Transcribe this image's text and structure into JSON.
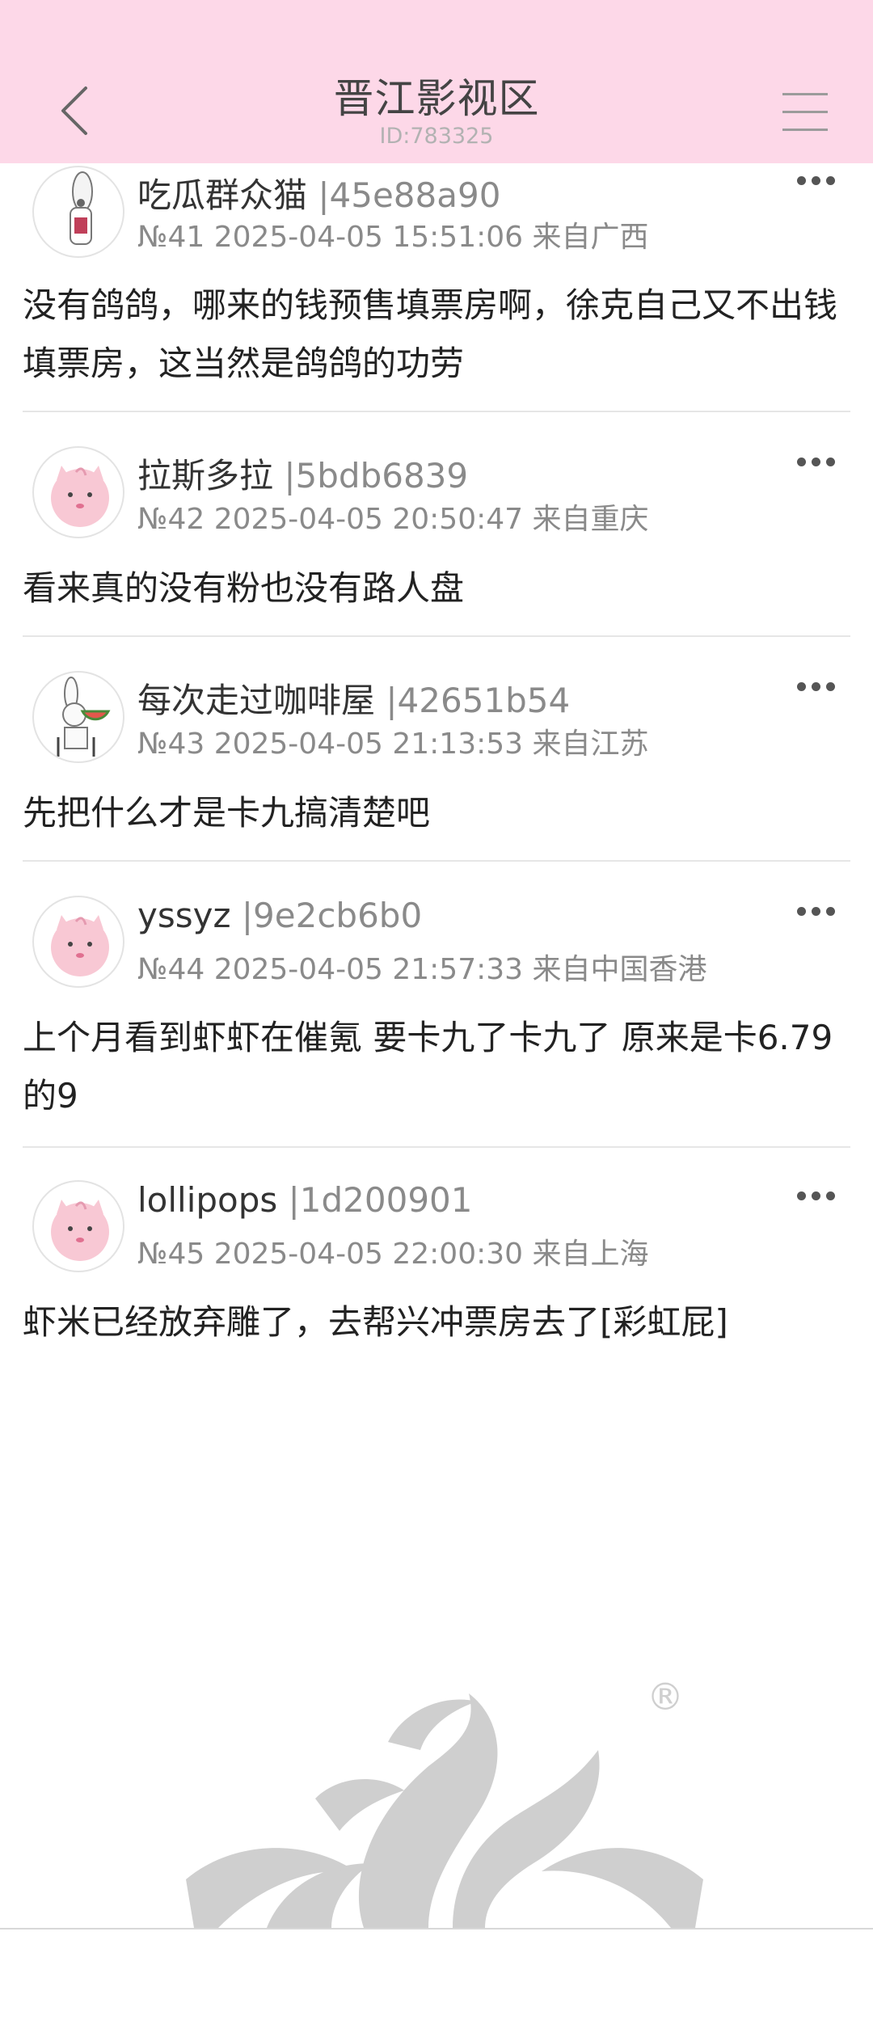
{
  "header": {
    "title": "晋江影视区",
    "subtitle": "ID:783325",
    "back_icon": "chevron-left-icon",
    "menu_icon": "hamburger-menu-icon",
    "bg_color": "#fdd8e8"
  },
  "posts": [
    {
      "username": "吃瓜群众猫",
      "uid": "|45e88a90",
      "meta": "№41 2025-04-05 15:51:06 来自广西",
      "content": "没有鸽鸽，哪来的钱预售填票房啊，徐克自己又不出钱填票房，这当然是鸽鸽的功劳",
      "avatar": "rabbit-avatar"
    },
    {
      "username": "拉斯多拉",
      "uid": "|5bdb6839",
      "meta": "№42 2025-04-05 20:50:47 来自重庆",
      "content": "看来真的没有粉也没有路人盘",
      "avatar": "pink-puff-avatar"
    },
    {
      "username": "每次走过咖啡屋",
      "uid": "|42651b54",
      "meta": "№43 2025-04-05 21:13:53 来自江苏",
      "content": "先把什么才是卡九搞清楚吧",
      "avatar": "watermelon-rabbit-avatar"
    },
    {
      "username": "yssyz",
      "uid": "|9e2cb6b0",
      "meta": "№44 2025-04-05 21:57:33 来自中国香港",
      "content": "上个月看到虾虾在催氪 要卡九了卡九了 原来是卡6.79的9",
      "avatar": "pink-puff-avatar"
    },
    {
      "username": "lollipops",
      "uid": "|1d200901",
      "meta": "№45 2025-04-05 22:00:30 来自上海",
      "content": "虾米已经放弃雕了，去帮兴冲票房去了[彩虹屁]",
      "avatar": "pink-puff-avatar"
    }
  ],
  "watermark": {
    "name": "jjwxc-logo-watermark",
    "mark": "®"
  }
}
